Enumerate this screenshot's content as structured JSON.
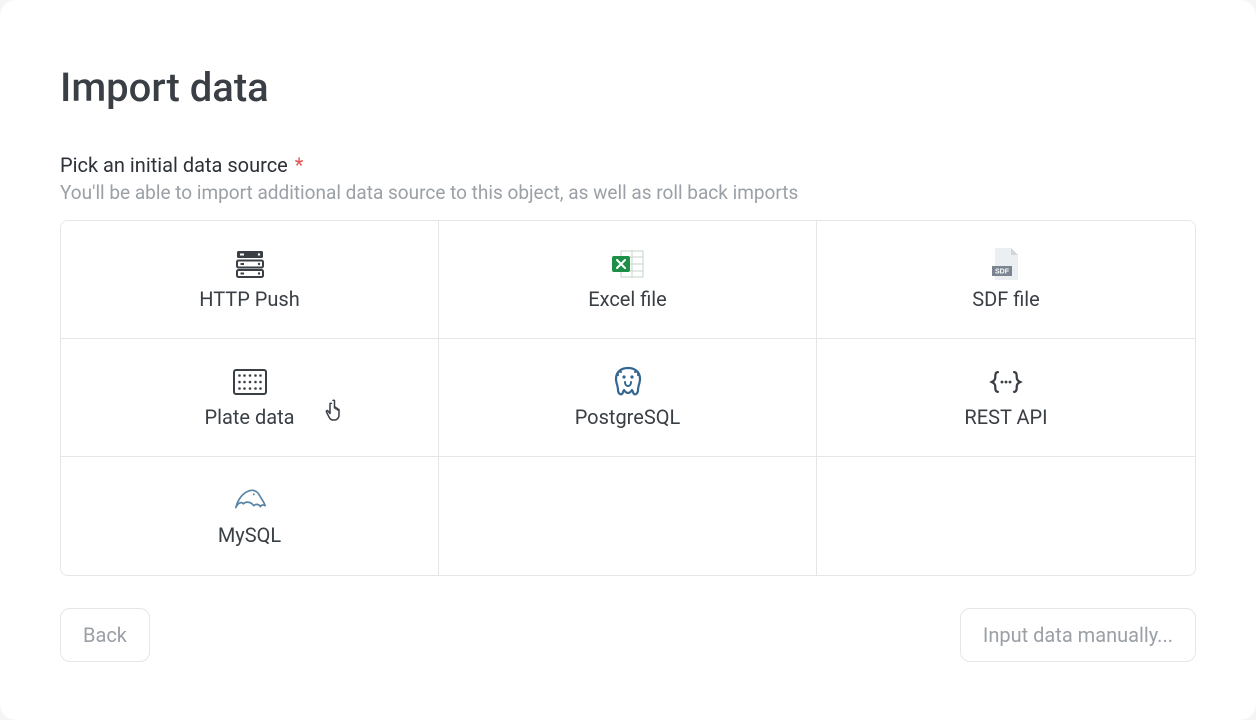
{
  "title": "Import data",
  "section": {
    "label": "Pick an initial data source",
    "required_mark": "*",
    "hint": "You'll be able to import additional data source to this object, as well as roll back imports"
  },
  "sources": [
    {
      "id": "http-push",
      "label": "HTTP Push",
      "icon": "server-stack"
    },
    {
      "id": "excel",
      "label": "Excel file",
      "icon": "excel"
    },
    {
      "id": "sdf",
      "label": "SDF file",
      "icon": "sdf-file"
    },
    {
      "id": "plate",
      "label": "Plate data",
      "icon": "plate-grid"
    },
    {
      "id": "postgresql",
      "label": "PostgreSQL",
      "icon": "elephant"
    },
    {
      "id": "restapi",
      "label": "REST API",
      "icon": "braces"
    },
    {
      "id": "mysql",
      "label": "MySQL",
      "icon": "dolphin"
    }
  ],
  "buttons": {
    "back": "Back",
    "manual": "Input data manually..."
  },
  "colors": {
    "excel_green": "#1d8f46",
    "postgres_blue": "#336791",
    "mysql_blue": "#5a86a5",
    "text_dark": "#3a3f45",
    "text_muted": "#9aa0a6",
    "border": "#e4e6ea",
    "required": "#e55353"
  }
}
